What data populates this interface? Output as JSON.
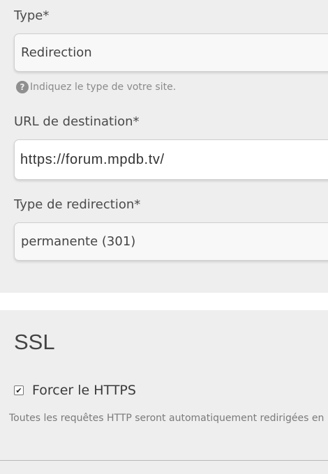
{
  "form": {
    "type_label": "Type*",
    "type_value": "Redirection",
    "type_hint_icon": "question-circle-icon",
    "type_hint": "Indiquez le type de votre site.",
    "url_label": "URL de destination*",
    "url_value": "https://forum.mpdb.tv/",
    "redirect_type_label": "Type de redirection*",
    "redirect_type_value": "permanente (301)"
  },
  "ssl": {
    "title": "SSL",
    "force_https_label": "Forcer le HTTPS",
    "force_https_checked": true,
    "description": "Toutes les requêtes HTTP seront automatiquement redirigées en HTTPS"
  }
}
